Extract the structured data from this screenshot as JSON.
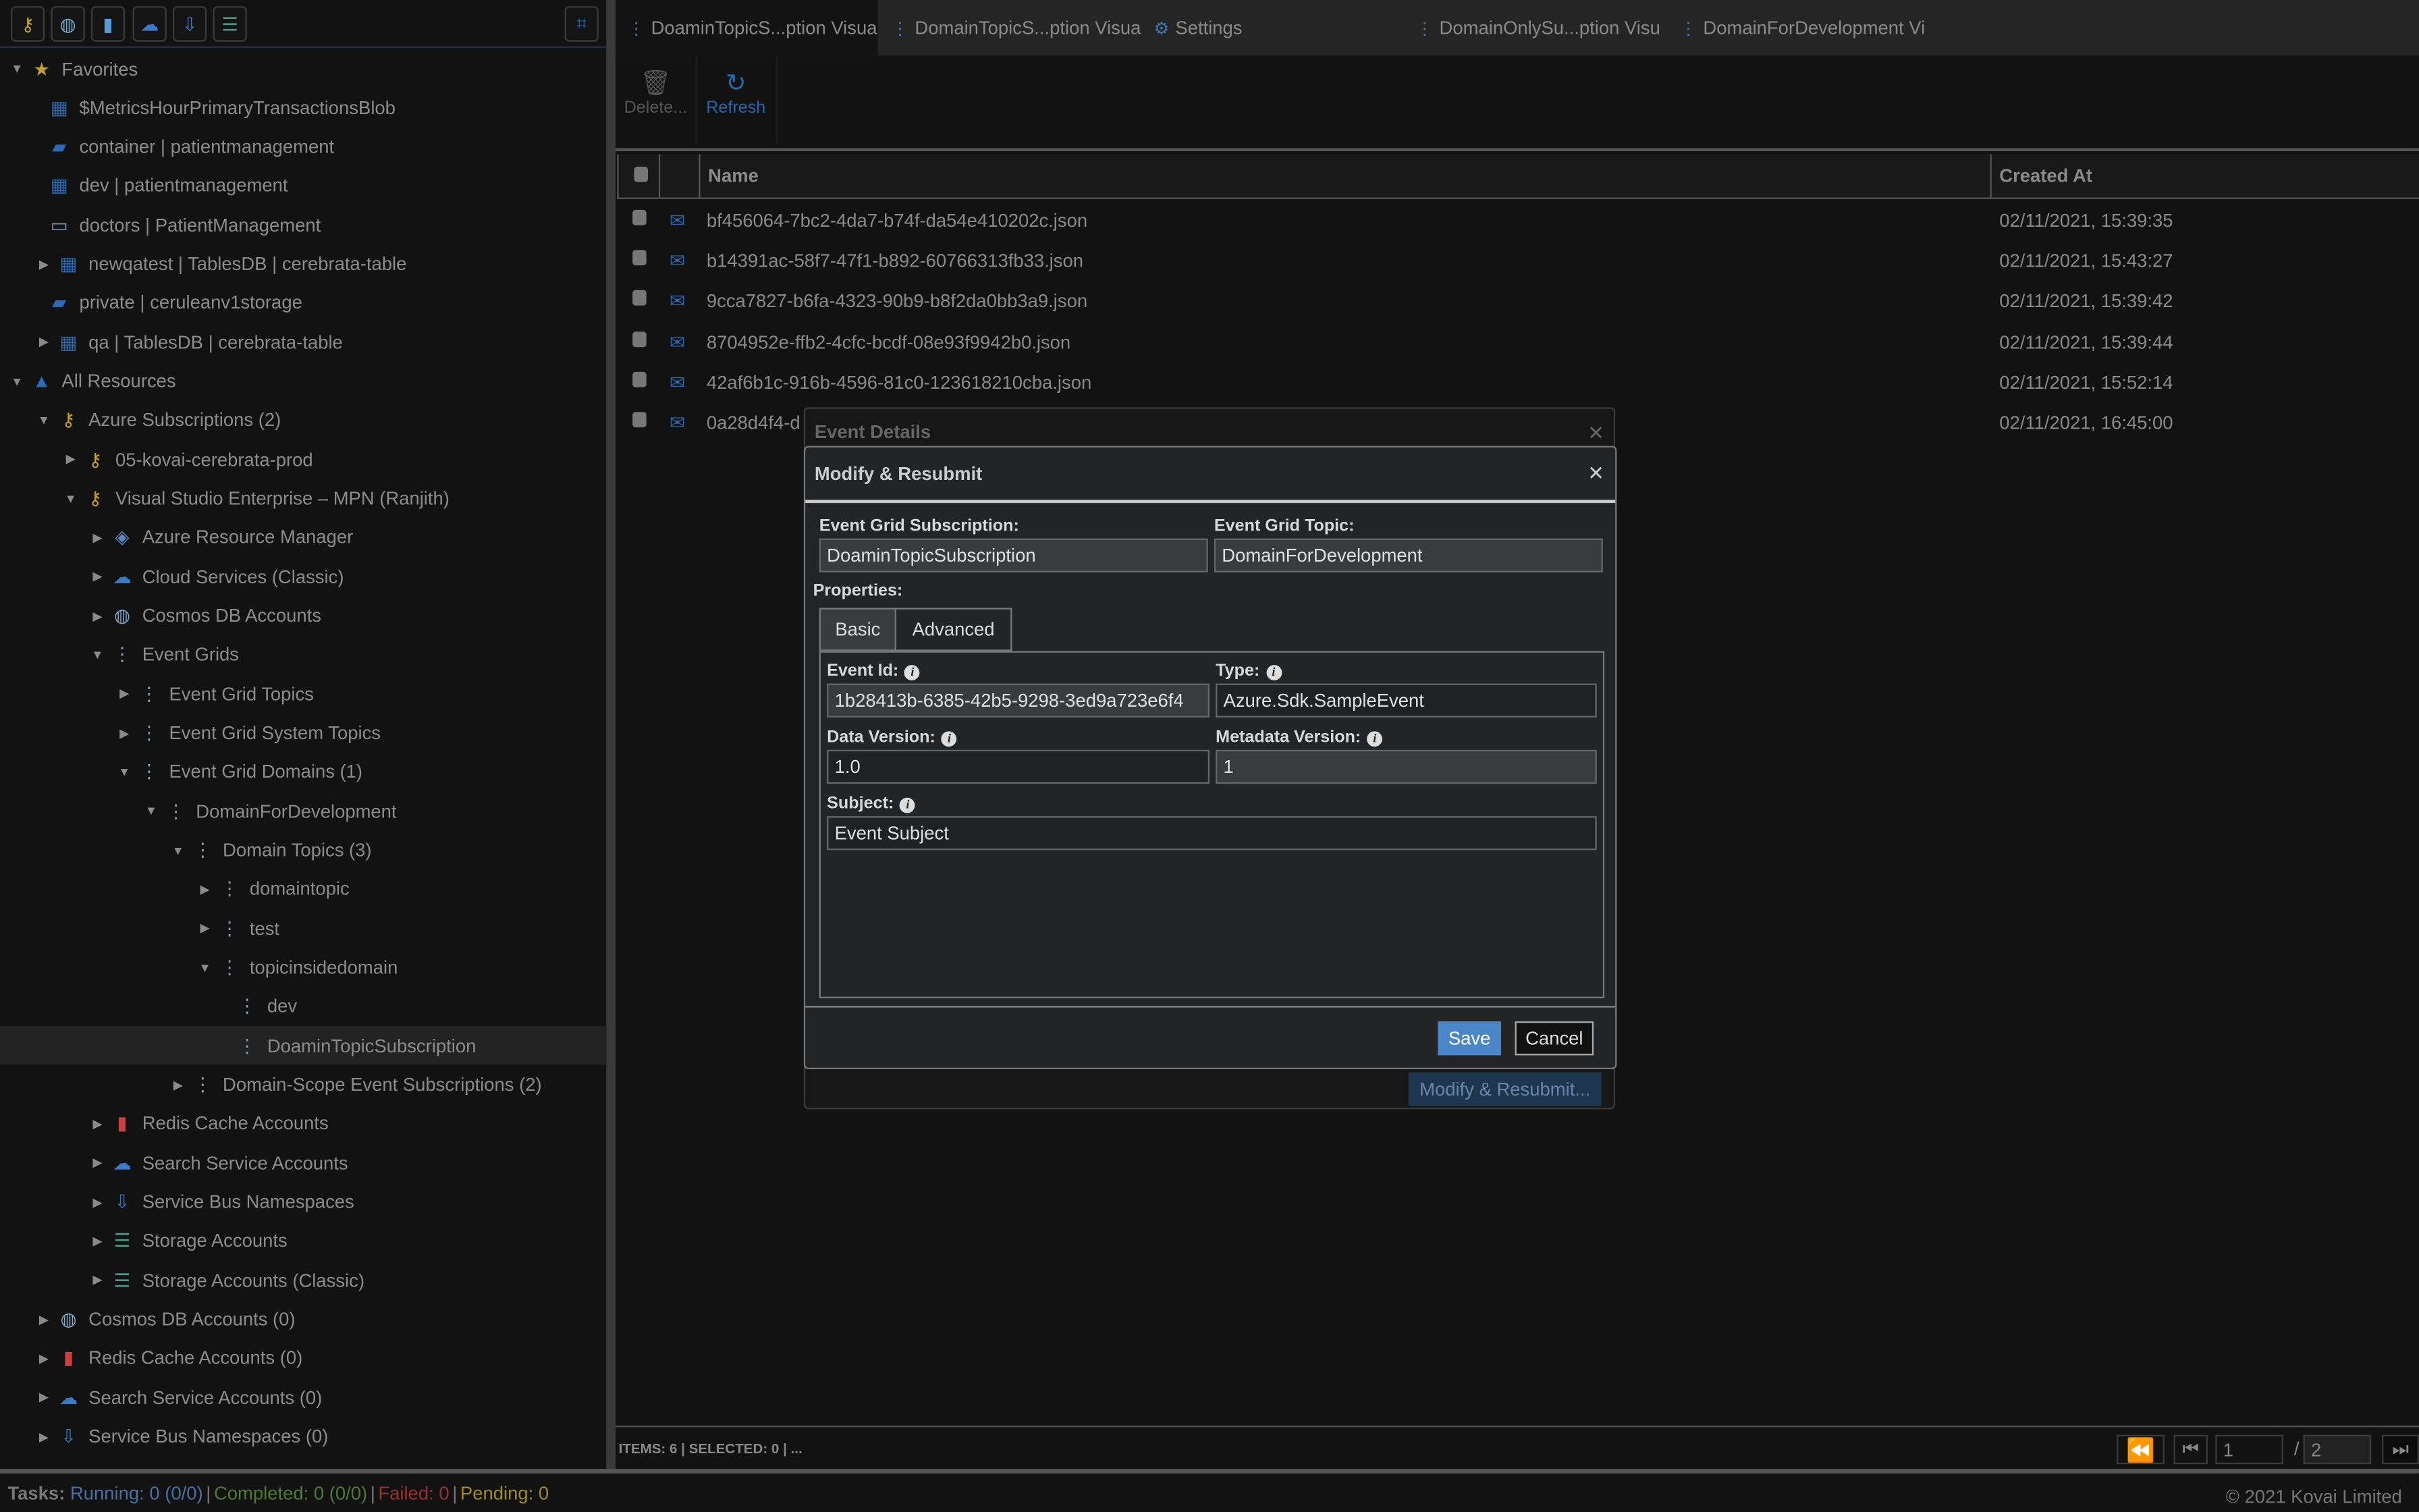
{
  "toolbar_left": {
    "icons": [
      "key-icon",
      "cosmos-icon",
      "redis-icon",
      "search-service-icon",
      "service-bus-icon",
      "storage-icon"
    ],
    "layout_icon": "layout-icon"
  },
  "tree": [
    {
      "label": "Favorites",
      "level": 0,
      "state": "expanded",
      "icon": "star-icon"
    },
    {
      "label": "$MetricsHourPrimaryTransactionsBlob",
      "level": 1,
      "state": "leaf",
      "icon": "table-icon"
    },
    {
      "label": "container | patientmanagement",
      "level": 1,
      "state": "leaf",
      "icon": "folder-icon"
    },
    {
      "label": "dev | patientmanagement",
      "level": 1,
      "state": "leaf",
      "icon": "table-icon"
    },
    {
      "label": "doctors | PatientManagement",
      "level": 1,
      "state": "leaf",
      "icon": "entity-icon"
    },
    {
      "label": "newqatest | TablesDB | cerebrata-table",
      "level": 1,
      "state": "collapsed",
      "icon": "table-icon"
    },
    {
      "label": "private | ceruleanv1storage",
      "level": 1,
      "state": "leaf",
      "icon": "folder-icon"
    },
    {
      "label": "qa | TablesDB | cerebrata-table",
      "level": 1,
      "state": "collapsed",
      "icon": "table-icon"
    },
    {
      "label": "All Resources",
      "level": 0,
      "state": "expanded",
      "icon": "azure-icon"
    },
    {
      "label": "Azure Subscriptions (2)",
      "level": 1,
      "state": "expanded",
      "icon": "key-icon"
    },
    {
      "label": "05-kovai-cerebrata-prod",
      "level": 2,
      "state": "collapsed",
      "icon": "key-icon"
    },
    {
      "label": "Visual Studio Enterprise – MPN (Ranjith)",
      "level": 2,
      "state": "expanded",
      "icon": "key-icon"
    },
    {
      "label": "Azure Resource Manager",
      "level": 3,
      "state": "collapsed",
      "icon": "cube-icon"
    },
    {
      "label": "Cloud Services (Classic)",
      "level": 3,
      "state": "collapsed",
      "icon": "cloud-icon"
    },
    {
      "label": "Cosmos DB Accounts",
      "level": 3,
      "state": "collapsed",
      "icon": "cosmos-icon"
    },
    {
      "label": "Event Grids",
      "level": 3,
      "state": "expanded",
      "icon": "event-grid-icon"
    },
    {
      "label": "Event Grid Topics",
      "level": 4,
      "state": "collapsed",
      "icon": "event-grid-icon"
    },
    {
      "label": "Event Grid System Topics",
      "level": 4,
      "state": "collapsed",
      "icon": "event-grid-icon"
    },
    {
      "label": "Event Grid Domains (1)",
      "level": 4,
      "state": "expanded",
      "icon": "event-grid-icon"
    },
    {
      "label": "DomainForDevelopment",
      "level": 5,
      "state": "expanded",
      "icon": "event-grid-icon"
    },
    {
      "label": "Domain Topics (3)",
      "level": 6,
      "state": "expanded",
      "icon": "event-grid-icon"
    },
    {
      "label": "domaintopic",
      "level": 7,
      "state": "collapsed",
      "icon": "event-grid-icon"
    },
    {
      "label": "test",
      "level": 7,
      "state": "collapsed",
      "icon": "event-grid-icon"
    },
    {
      "label": "topicinsidedomain",
      "level": 7,
      "state": "expanded",
      "icon": "event-grid-icon"
    },
    {
      "label": "dev",
      "level": 8,
      "state": "leaf",
      "icon": "subscription-icon"
    },
    {
      "label": "DoaminTopicSubscription",
      "level": 8,
      "state": "leaf",
      "icon": "subscription-icon",
      "selected": true
    },
    {
      "label": "Domain-Scope Event Subscriptions (2)",
      "level": 6,
      "state": "collapsed",
      "icon": "event-grid-icon"
    },
    {
      "label": "Redis Cache Accounts",
      "level": 3,
      "state": "collapsed",
      "icon": "redis-icon"
    },
    {
      "label": "Search Service Accounts",
      "level": 3,
      "state": "collapsed",
      "icon": "search-service-icon"
    },
    {
      "label": "Service Bus Namespaces",
      "level": 3,
      "state": "collapsed",
      "icon": "service-bus-icon"
    },
    {
      "label": "Storage Accounts",
      "level": 3,
      "state": "collapsed",
      "icon": "storage-icon"
    },
    {
      "label": "Storage Accounts (Classic)",
      "level": 3,
      "state": "collapsed",
      "icon": "storage-icon"
    },
    {
      "label": "Cosmos DB Accounts (0)",
      "level": 1,
      "state": "collapsed",
      "icon": "cosmos-icon"
    },
    {
      "label": "Redis Cache Accounts (0)",
      "level": 1,
      "state": "collapsed",
      "icon": "redis-icon"
    },
    {
      "label": "Search Service Accounts (0)",
      "level": 1,
      "state": "collapsed",
      "icon": "search-service-icon"
    },
    {
      "label": "Service Bus Namespaces (0)",
      "level": 1,
      "state": "collapsed",
      "icon": "service-bus-icon"
    }
  ],
  "tabs": [
    {
      "label": "DoaminTopicS...ption Visua",
      "icon": "event-grid-icon",
      "active": true
    },
    {
      "label": "DomainTopicS...ption Visua",
      "icon": "event-grid-icon"
    },
    {
      "label": "Settings",
      "icon": "gear-icon"
    },
    {
      "label": "DomainOnlySu...ption Visu",
      "icon": "event-grid-icon"
    },
    {
      "label": "DomainForDevelopment Vi",
      "icon": "event-grid-icon"
    }
  ],
  "actions": {
    "delete": "Delete...",
    "refresh": "Refresh"
  },
  "grid": {
    "columns": [
      "Name",
      "Created At"
    ],
    "rows": [
      {
        "name": "bf456064-7bc2-4da7-b74f-da54e410202c.json",
        "created": "02/11/2021, 15:39:35"
      },
      {
        "name": "b14391ac-58f7-47f1-b892-60766313fb33.json",
        "created": "02/11/2021, 15:43:27"
      },
      {
        "name": "9cca7827-b6fa-4323-90b9-b8f2da0bb3a9.json",
        "created": "02/11/2021, 15:39:42"
      },
      {
        "name": "8704952e-ffb2-4cfc-bcdf-08e93f9942b0.json",
        "created": "02/11/2021, 15:39:44"
      },
      {
        "name": "42af6b1c-916b-4596-81c0-123618210cba.json",
        "created": "02/11/2021, 15:52:14"
      },
      {
        "name": "0a28d4f4-d",
        "created": "02/11/2021, 16:45:00"
      }
    ],
    "footer": "ITEMS: 6 | SELECTED: 0 |  ...",
    "page_current": "1",
    "page_sep": "/",
    "page_total": "2"
  },
  "event_details": {
    "title": "Event Details",
    "modify_button": "Modify & Resubmit..."
  },
  "modal": {
    "title": "Modify & Resubmit",
    "subscription_label": "Event Grid Subscription:",
    "subscription_value": "DoaminTopicSubscription",
    "topic_label": "Event Grid Topic:",
    "topic_value": "DomainForDevelopment",
    "properties_label": "Properties:",
    "tabs": [
      "Basic",
      "Advanced"
    ],
    "event_id_label": "Event Id:",
    "event_id_value": "1b28413b-6385-42b5-9298-3ed9a723e6f4",
    "type_label": "Type:",
    "type_value": "Azure.Sdk.SampleEvent",
    "data_version_label": "Data Version:",
    "data_version_value": "1.0",
    "metadata_version_label": "Metadata Version:",
    "metadata_version_value": "1",
    "subject_label": "Subject:",
    "subject_value": "Event Subject",
    "save": "Save",
    "cancel": "Cancel",
    "accent": "#4a86c8"
  },
  "status": {
    "tasks": "Tasks:",
    "running": "Running: 0 (0/0)",
    "completed": "Completed: 0 (0/0)",
    "failed": "Failed: 0",
    "pending": "Pending: 0",
    "sep": "|",
    "copyright": "© 2021 Kovai Limited",
    "colors": {
      "running": "#4a6fa0",
      "completed": "#4f7a34",
      "failed": "#9a3030",
      "pending": "#a08a2a"
    }
  }
}
